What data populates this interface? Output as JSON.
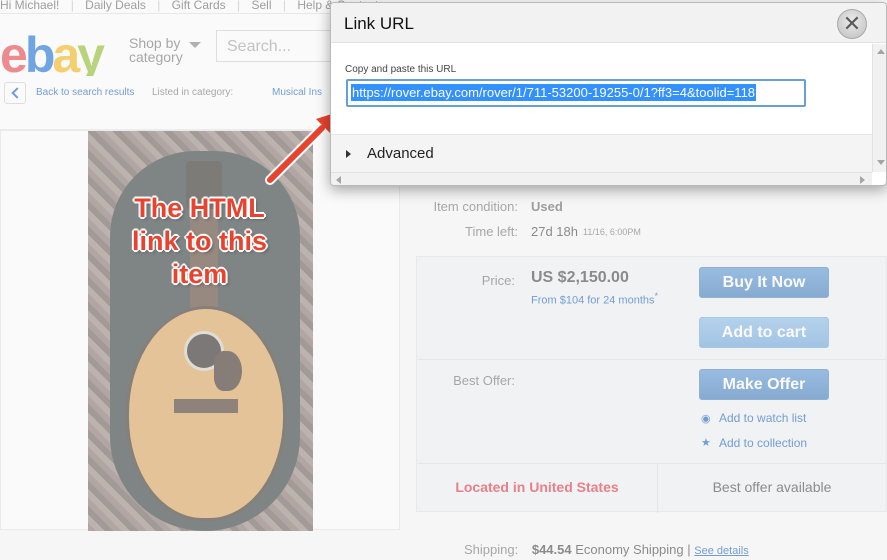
{
  "topbar": {
    "greeting": "Hi Michael!",
    "links": [
      "Daily Deals",
      "Gift Cards",
      "Sell",
      "Help & Contact"
    ]
  },
  "header": {
    "shop_by_line1": "Shop by",
    "shop_by_line2": "category",
    "search_placeholder": "Search..."
  },
  "breadcrumb": {
    "back": "Back to search results",
    "listed_in": "Listed in category:",
    "category": "Musical Ins"
  },
  "photo": {
    "annotation_line1": "The HTML",
    "annotation_line2": "link to this",
    "annotation_line3": "item"
  },
  "details": {
    "condition_label": "Item condition:",
    "condition_value": "Used",
    "time_left_label": "Time left:",
    "time_left_value": "27d 18h",
    "time_left_date": "11/16, 6:00PM",
    "price_label": "Price:",
    "price_value": "US $2,150.00",
    "finance_text": "From $104 for 24 months",
    "finance_mark": "*",
    "buy_now": "Buy It Now",
    "add_to_cart": "Add to cart",
    "best_offer_label": "Best Offer:",
    "make_offer": "Make Offer",
    "watch_list": "Add to watch list",
    "collection": "Add to collection",
    "located": "Located in United States",
    "best_offer_available": "Best offer available",
    "shipping_label": "Shipping:",
    "shipping_amount": "$44.54",
    "shipping_method": "Economy Shipping",
    "shipping_sep": "|",
    "see_details": "See details"
  },
  "dialog": {
    "title": "Link URL",
    "close_glyph": "✕",
    "hint": "Copy and paste this URL",
    "url_value": "https://rover.ebay.com/rover/1/711-53200-19255-0/1?ff3=4&toolid=118",
    "advanced": "Advanced"
  },
  "colors": {
    "link": "#0654ba",
    "annotation": "#e8432f",
    "selection": "#3390ff",
    "button": "#2c6cb4",
    "located": "#dd1e31"
  }
}
